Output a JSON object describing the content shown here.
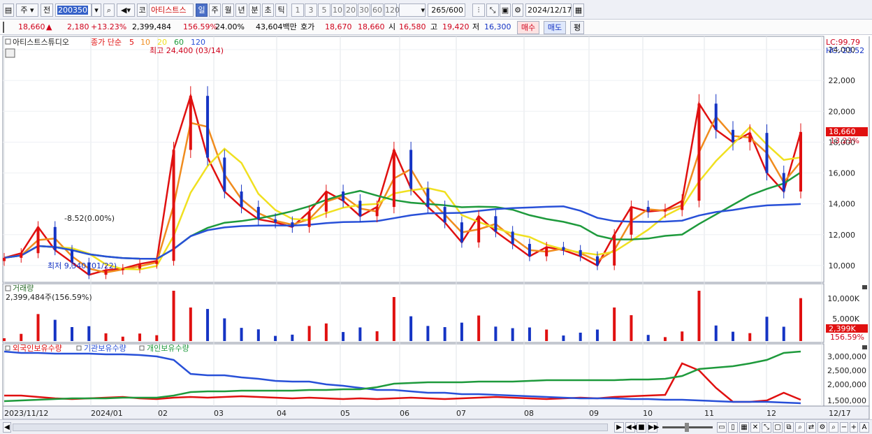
{
  "toolbar": {
    "period_type": "주",
    "prev_label": "전",
    "code": "200350",
    "market_badge": "코",
    "stock_name": "아티스트스",
    "timeframes": [
      "일",
      "주",
      "월",
      "년",
      "분",
      "초",
      "틱"
    ],
    "active_timeframe": "일",
    "intervals": [
      "1",
      "3",
      "5",
      "10",
      "20",
      "30",
      "60",
      "120"
    ],
    "count": "265",
    "count_max": "/600",
    "date": "2024/12/17"
  },
  "infobar": {
    "price": "18,660",
    "up_mark": "▲",
    "change": "2,180",
    "change_pct": "+13.23%",
    "volume": "2,399,484",
    "volume_ratio": "156.59%",
    "turnover": "24.00%",
    "amount": "43,604백만",
    "hoga_label": "호가",
    "ask": "18,670",
    "bid": "18,660",
    "open_label": "시",
    "open": "16,580",
    "high_label": "고",
    "high": "19,420",
    "low_label": "저",
    "low": "16,300",
    "buy_label": "매수",
    "sell_label": "매도",
    "flat_label": "평"
  },
  "price_pane": {
    "stock_label": "아티스트스튜디오",
    "ma_label": "종가 단순",
    "ma_periods": [
      "5",
      "10",
      "20",
      "60",
      "120"
    ],
    "ma_colors": [
      "#e01010",
      "#f08c1e",
      "#f0e020",
      "#1e9a3c",
      "#2850d8"
    ],
    "max_label": "최고 24,400 (03/14)",
    "min_label": "최저 9,340 (01/22)",
    "mid_label": "-8.52(0.00%)",
    "lc_label": "LC:99.79",
    "hc_label": "HC:-23.52",
    "current_tag": "18,660",
    "current_pct": "13.23%",
    "y_ticks": [
      "24,000",
      "22,000",
      "20,000",
      "18,000",
      "16,000",
      "14,000",
      "12,000",
      "10,000"
    ]
  },
  "volume_pane": {
    "title": "거래량",
    "value_label": "2,399,484주(156.59%)",
    "y_ticks": [
      "10,000K",
      "5,000K"
    ],
    "current_tag": "2,399K",
    "current_pct": "156.59%"
  },
  "holdings_pane": {
    "series": [
      "외국인보유수량",
      "기관보유수량",
      "개인보유수량"
    ],
    "colors": [
      "#e01010",
      "#2850d8",
      "#1e9a3c"
    ],
    "y_ticks": [
      "3,000,000",
      "2,500,000",
      "2,000,000",
      "1,500,000"
    ]
  },
  "x_axis": {
    "labels": [
      "2023/11/12",
      "2024/01",
      "02",
      "03",
      "04",
      "05",
      "06",
      "07",
      "08",
      "09",
      "10",
      "11",
      "12",
      "12/17"
    ]
  },
  "chart_data": {
    "type": "line",
    "title": "",
    "ylim": [
      9000,
      24500
    ],
    "series": [
      {
        "name": "종가",
        "values": [
          10500,
          10800,
          12500,
          11000,
          10200,
          9400,
          9700,
          9800,
          10100,
          10300,
          17500,
          21000,
          17000,
          14800,
          13800,
          13000,
          12800,
          12500,
          13500,
          14800,
          14200,
          13200,
          13800,
          17500,
          15000,
          13800,
          12800,
          11500,
          13200,
          12200,
          11400,
          10600,
          11200,
          11000,
          10600,
          10000,
          12000,
          13800,
          13500,
          13600,
          14200,
          20500,
          18800,
          18000,
          18600,
          16000,
          14800,
          18660
        ]
      }
    ]
  }
}
